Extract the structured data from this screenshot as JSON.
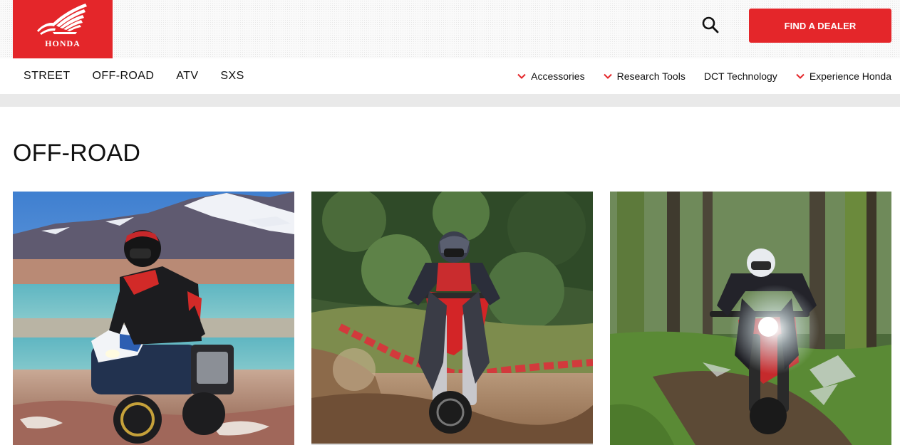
{
  "brand": {
    "name": "HONDA",
    "color": "#e4262a"
  },
  "header": {
    "search_icon": "search-icon",
    "find_dealer_label": "FIND A DEALER"
  },
  "nav": {
    "primary": [
      {
        "label": "STREET"
      },
      {
        "label": "OFF-ROAD"
      },
      {
        "label": "ATV"
      },
      {
        "label": "SXS"
      }
    ],
    "secondary": [
      {
        "label": "Accessories",
        "icon": "chevron-down-icon"
      },
      {
        "label": "Research Tools",
        "icon": "chevron-down-icon"
      },
      {
        "label": "DCT Technology",
        "icon": ""
      },
      {
        "label": "Experience Honda",
        "icon": "chevron-down-icon"
      }
    ]
  },
  "main": {
    "title": "OFF-ROAD",
    "cards": [
      {
        "image": "adventure-rider-mountain-lake-photo"
      },
      {
        "image": "motocross-rider-dirt-jump-photo"
      },
      {
        "image": "trail-rider-forest-mud-photo"
      }
    ]
  }
}
